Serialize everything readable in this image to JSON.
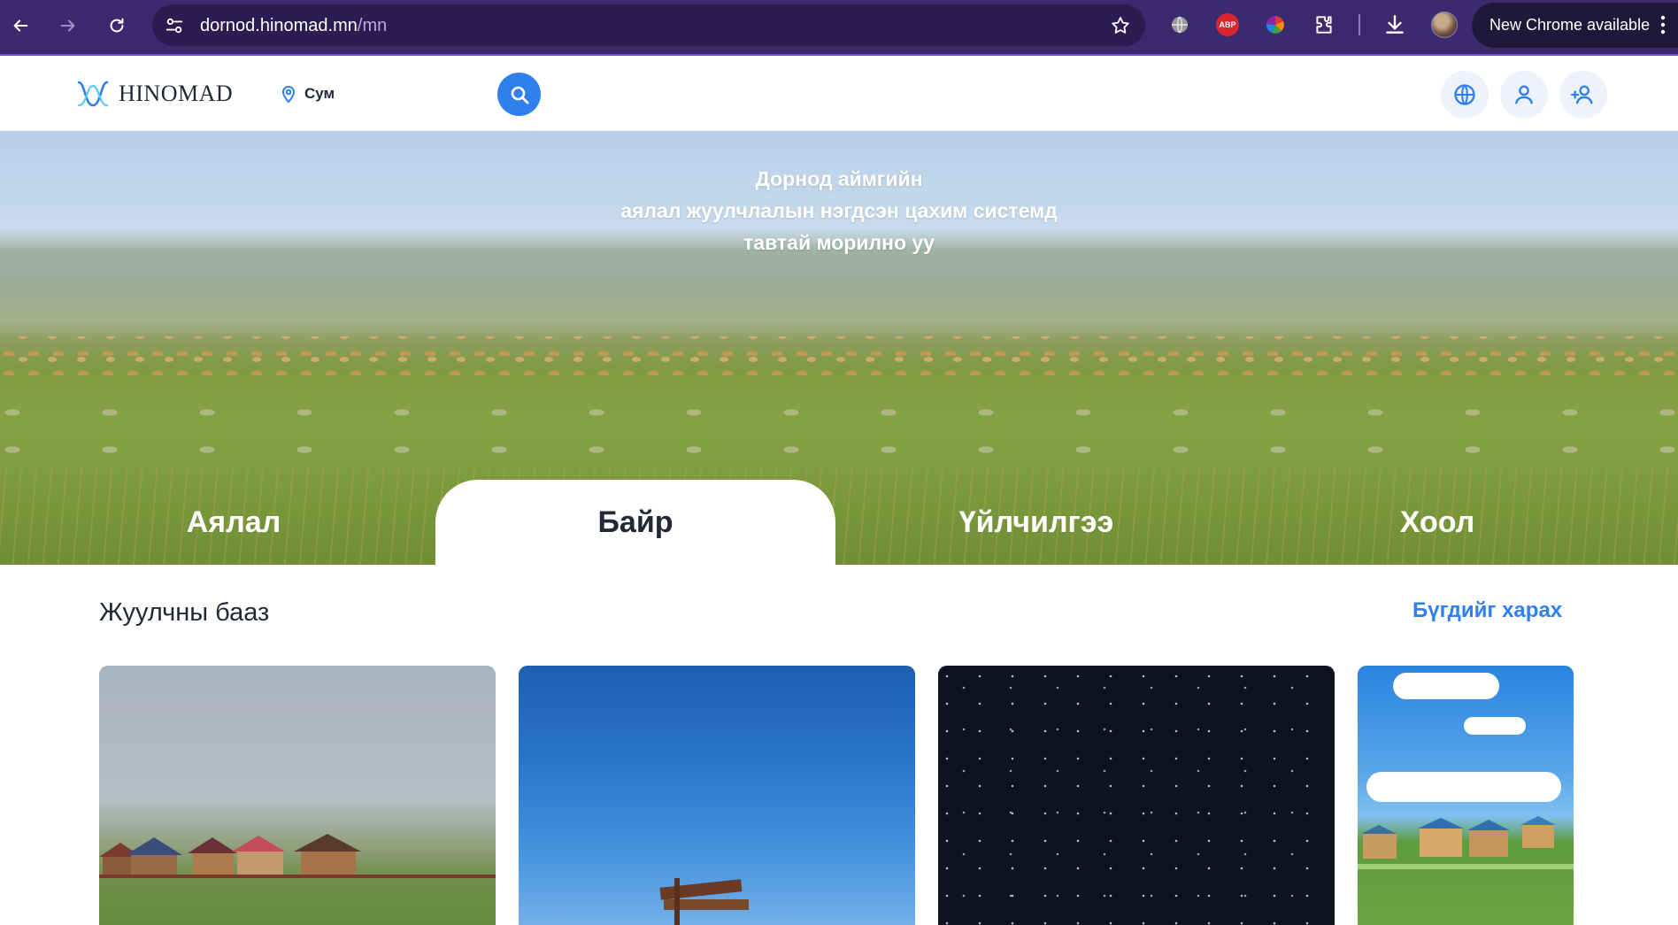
{
  "browser": {
    "url_host": "dornod.hinomad.mn",
    "url_path": "/mn",
    "update_label": "New Chrome available",
    "abp_label": "ABP"
  },
  "header": {
    "logo_text": "HINOMAD",
    "location_label": "Сум"
  },
  "hero": {
    "lines": [
      "Дорнод аймгийн",
      "аялал жуулчлалын нэгдсэн цахим системд",
      "тавтай морилно уу"
    ],
    "tabs": [
      {
        "label": "Аялал",
        "active": false
      },
      {
        "label": "Байр",
        "active": true
      },
      {
        "label": "Үйлчилгээ",
        "active": false
      },
      {
        "label": "Хоол",
        "active": false
      }
    ]
  },
  "section": {
    "title": "Жуулчны бааз",
    "see_all": "Бүгдийг харах"
  },
  "colors": {
    "browser_frame": "#3c2a6e",
    "omnibox": "#2a1d52",
    "accent_blue": "#2f80ed",
    "header_icon_bg": "#eef3fb"
  },
  "icons": {
    "browser": [
      "back-arrow-icon",
      "forward-arrow-icon",
      "reload-icon",
      "site-settings-icon",
      "bookmark-star-icon",
      "translate-globe-icon",
      "adblock-icon",
      "color-wheel-extension-icon",
      "extensions-puzzle-icon",
      "download-icon",
      "kebab-menu-icon"
    ],
    "site": [
      "hinomad-logo-icon",
      "location-pin-icon",
      "search-icon",
      "language-globe-icon",
      "user-icon",
      "add-user-icon"
    ]
  }
}
